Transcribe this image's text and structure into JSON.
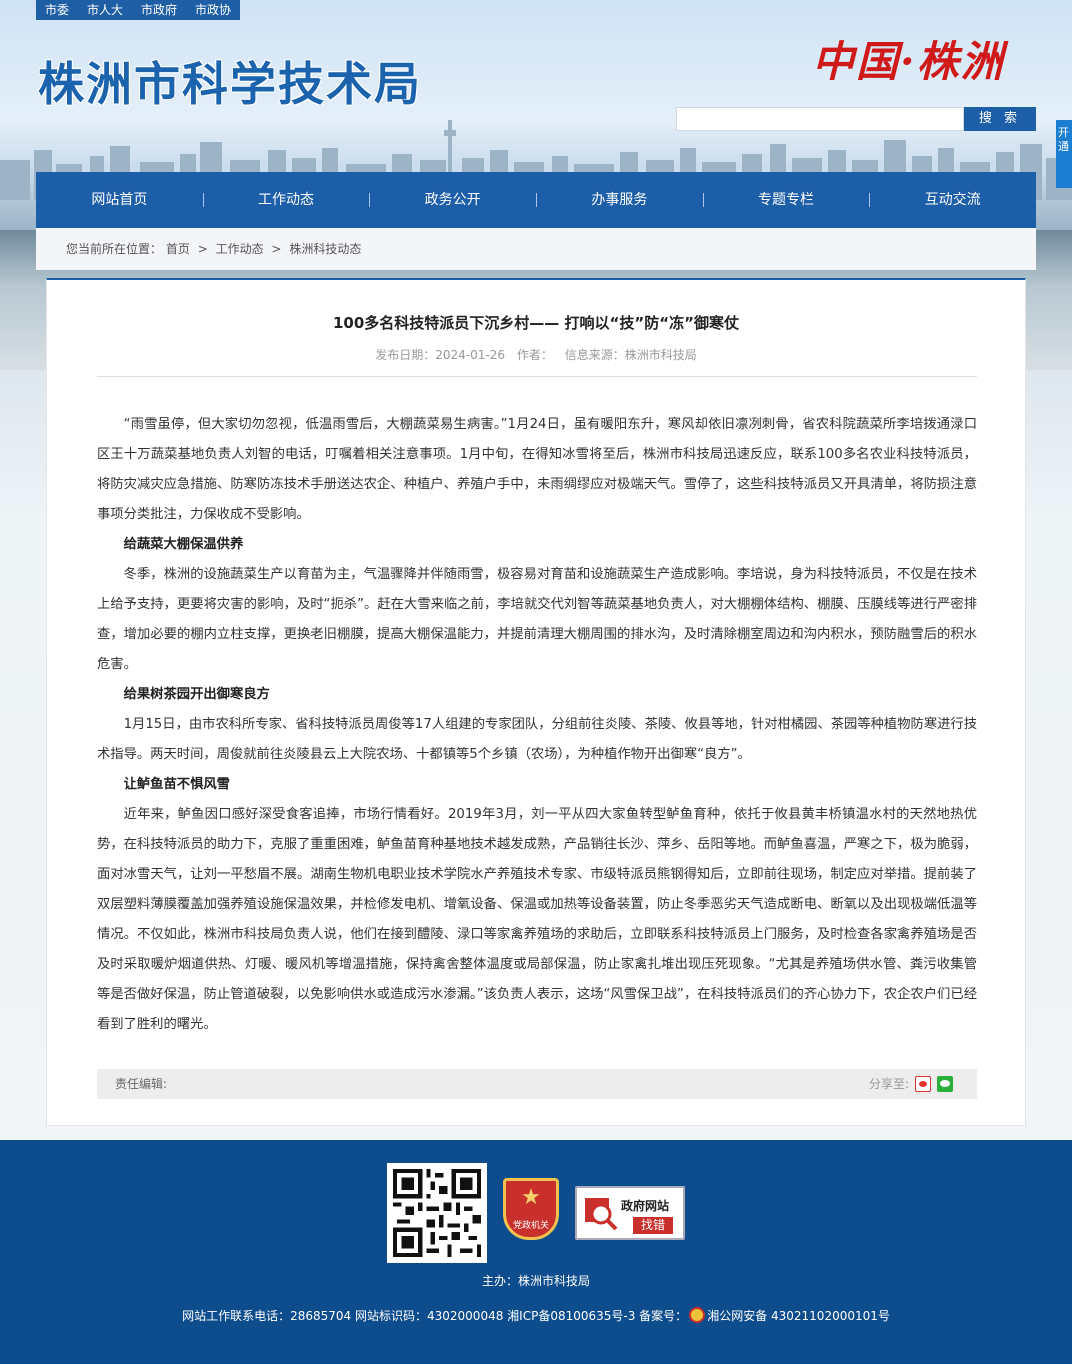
{
  "topbar": {
    "links": [
      "市委",
      "市人大",
      "市政府",
      "市政协"
    ]
  },
  "header": {
    "site_title": "株洲市科学技术局",
    "calligraphy": "中国·株洲",
    "search_placeholder": "",
    "search_button": "搜 索",
    "side_float": "开通"
  },
  "nav": {
    "items": [
      "网站首页",
      "工作动态",
      "政务公开",
      "办事服务",
      "专题专栏",
      "互动交流"
    ]
  },
  "breadcrumb": {
    "prefix": "您当前所在位置：",
    "items": [
      "首页",
      "工作动态",
      "株洲科技动态"
    ],
    "separator": ">"
  },
  "article": {
    "title": "100多名科技特派员下沉乡村—— 打响以“技”防“冻”御寒仗",
    "publish_label": "发布日期：2024-01-26",
    "author_label": "作者：",
    "source_label": "信息来源：株洲市科技局",
    "paragraphs": [
      {
        "type": "text",
        "text": "“雨雪虽停，但大家切勿忽视，低温雨雪后，大棚蔬菜易生病害。”1月24日，虽有暖阳东升，寒风却依旧凛冽刺骨，省农科院蔬菜所李培拨通渌口区王十万蔬菜基地负责人刘智的电话，叮嘱着相关注意事项。1月中旬，在得知冰雪将至后，株洲市科技局迅速反应，联系100多名农业科技特派员，将防灾减灾应急措施、防寒防冻技术手册送达农企、种植户、养殖户手中，未雨绸缪应对极端天气。雪停了，这些科技特派员又开具清单，将防损注意事项分类批注，力保收成不受影响。"
      },
      {
        "type": "sub",
        "text": "给蔬菜大棚保温供养"
      },
      {
        "type": "text",
        "text": "冬季，株洲的设施蔬菜生产以育苗为主，气温骤降并伴随雨雪，极容易对育苗和设施蔬菜生产造成影响。李培说，身为科技特派员，不仅是在技术上给予支持，更要将灾害的影响，及时“扼杀”。赶在大雪来临之前，李培就交代刘智等蔬菜基地负责人，对大棚棚体结构、棚膜、压膜线等进行严密排查，增加必要的棚内立柱支撑，更换老旧棚膜，提高大棚保温能力，并提前清理大棚周围的排水沟，及时清除棚室周边和沟内积水，预防融雪后的积水危害。"
      },
      {
        "type": "sub",
        "text": "给果树茶园开出御寒良方"
      },
      {
        "type": "text",
        "text": "1月15日，由市农科所专家、省科技特派员周俊等17人组建的专家团队，分组前往炎陵、茶陵、攸县等地，针对柑橘园、茶园等种植物防寒进行技术指导。两天时间，周俊就前往炎陵县云上大院农场、十都镇等5个乡镇（农场），为种植作物开出御寒“良方”。"
      },
      {
        "type": "sub",
        "text": "让鲈鱼苗不惧风雪"
      },
      {
        "type": "text",
        "text": "近年来，鲈鱼因口感好深受食客追捧，市场行情看好。2019年3月，刘一平从四大家鱼转型鲈鱼育种，依托于攸县黄丰桥镇温水村的天然地热优势，在科技特派员的助力下，克服了重重困难，鲈鱼苗育种基地技术越发成熟，产品销往长沙、萍乡、岳阳等地。而鲈鱼喜温，严寒之下，极为脆弱，面对冰雪天气，让刘一平愁眉不展。湖南生物机电职业技术学院水产养殖技术专家、市级特派员熊钢得知后，立即前往现场，制定应对举措。提前装了双层塑料薄膜覆盖加强养殖设施保温效果，并检修发电机、增氧设备、保温或加热等设备装置，防止冬季恶劣天气造成断电、断氧以及出现极端低温等情况。不仅如此，株洲市科技局负责人说，他们在接到醴陵、渌口等家禽养殖场的求助后，立即联系科技特派员上门服务，及时检查各家禽养殖场是否及时采取暖炉烟道供热、灯暖、暖风机等增温措施，保持禽舍整体温度或局部保温，防止家禽扎堆出现压死现象。“尤其是养殖场供水管、粪污收集管等是否做好保温，防止管道破裂，以免影响供水或造成污水渗漏。”该负责人表示，这场“风雪保卫战”，在科技特派员们的齐心协力下，农企农户们已经看到了胜利的曙光。"
      }
    ],
    "editor_label": "责任编辑:",
    "share_label": "分享至:"
  },
  "footer": {
    "party_label": "党政机关",
    "error_title": "政府网站",
    "error_btn": "找错",
    "sponsor": "主办：株洲市科技局",
    "info_prefix": "网站工作联系电话：28685704 网站标识码：4302000048 湘ICP备08100635号-3 备案号：",
    "info_suffix": "湘公网安备 43021102000101号"
  },
  "colors": {
    "brand_blue": "#1c5ea8",
    "footer_blue": "#0d4c8d",
    "accent_red": "#d01a1a"
  }
}
